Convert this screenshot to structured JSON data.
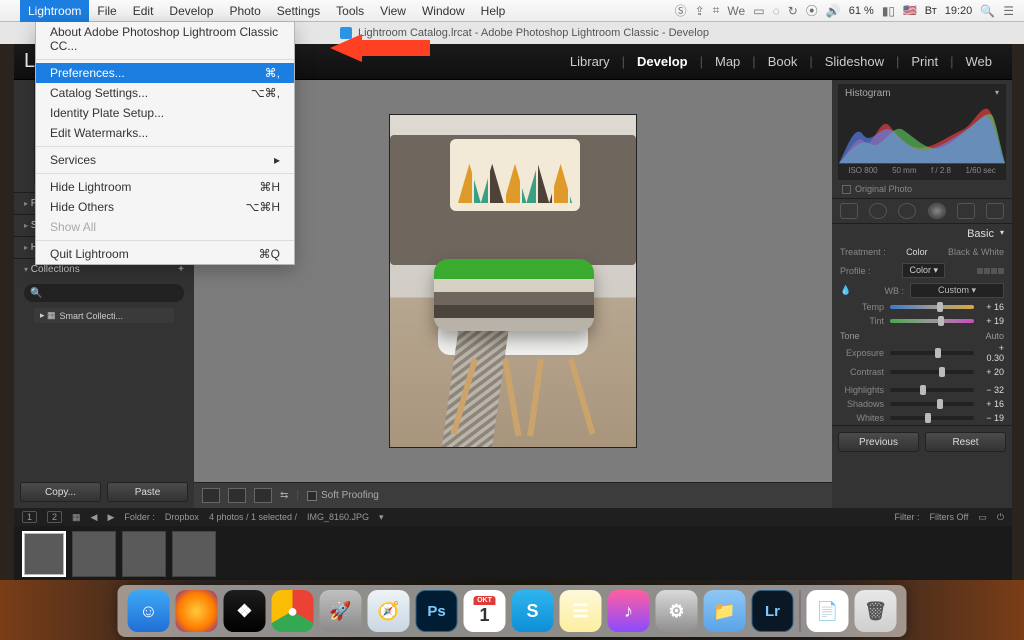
{
  "menubar": {
    "apple": "",
    "items": [
      "Lightroom",
      "File",
      "Edit",
      "Develop",
      "Photo",
      "Settings",
      "Tools",
      "View",
      "Window",
      "Help"
    ],
    "active_index": 0,
    "status": {
      "battery": "61 %",
      "flag": "🇺🇸",
      "day": "Вт",
      "time": "19:20"
    }
  },
  "dropdown": {
    "about": "About Adobe Photoshop Lightroom Classic CC...",
    "preferences": {
      "label": "Preferences...",
      "shortcut": "⌘,"
    },
    "catalog": {
      "label": "Catalog Settings...",
      "shortcut": "⌥⌘,"
    },
    "identity": "Identity Plate Setup...",
    "watermarks": "Edit Watermarks...",
    "services": "Services",
    "hide_lr": {
      "label": "Hide Lightroom",
      "shortcut": "⌘H"
    },
    "hide_others": {
      "label": "Hide Others",
      "shortcut": "⌥⌘H"
    },
    "show_all": "Show All",
    "quit": {
      "label": "Quit Lightroom",
      "shortcut": "⌘Q"
    }
  },
  "titlebar": {
    "text": "Lightroom Catalog.lrcat - Adobe Photoshop Lightroom Classic - Develop"
  },
  "app_top": {
    "logo": "L",
    "modules": [
      "Library",
      "Develop",
      "Map",
      "Book",
      "Slideshow",
      "Print",
      "Web"
    ],
    "active": "Develop"
  },
  "left_panel": {
    "presets": "Presets",
    "snapshots": "Snapshots",
    "history": "History",
    "collections": "Collections",
    "search_placeholder": "",
    "smart": "Smart Collecti...",
    "copy": "Copy...",
    "paste": "Paste"
  },
  "toolbar_bottom": {
    "soft": "Soft Proofing"
  },
  "right_panel": {
    "histogram_title": "Histogram",
    "meta": {
      "iso": "ISO 800",
      "focal": "50 mm",
      "aperture": "f / 2.8",
      "shutter": "1/60 sec"
    },
    "original": "Original Photo",
    "basic": "Basic",
    "treatment": {
      "label": "Treatment :",
      "color": "Color",
      "bw": "Black & White"
    },
    "profile": {
      "label": "Profile :",
      "value": "Color"
    },
    "wb": {
      "label": "WB :",
      "value": "Custom"
    },
    "temp": {
      "label": "Temp",
      "value": "+ 16"
    },
    "tint": {
      "label": "Tint",
      "value": "+ 19"
    },
    "tone": {
      "label": "Tone",
      "auto": "Auto"
    },
    "exposure": {
      "label": "Exposure",
      "value": "+ 0.30"
    },
    "contrast": {
      "label": "Contrast",
      "value": "+ 20"
    },
    "highlights": {
      "label": "Highlights",
      "value": "− 32"
    },
    "shadows": {
      "label": "Shadows",
      "value": "+ 16"
    },
    "whites": {
      "label": "Whites",
      "value": "− 19"
    },
    "previous": "Previous",
    "reset": "Reset"
  },
  "filmstrip_bar": {
    "pages": [
      "1",
      "2"
    ],
    "folder_label": "Folder :",
    "folder": "Dropbox",
    "count": "4 photos / 1 selected /",
    "filename": "IMG_8160.JPG",
    "filter_label": "Filter :",
    "filter_value": "Filters Off"
  },
  "dock": {
    "items": [
      {
        "name": "finder",
        "bg": "linear-gradient(#3fa8f4,#1f6fd6)",
        "txt": "☺"
      },
      {
        "name": "firefox",
        "bg": "radial-gradient(#ffca3a,#ff7b00 60%,#7b2da0)",
        "txt": ""
      },
      {
        "name": "vivaldi",
        "bg": "linear-gradient(#1d1d1d,#000)",
        "txt": "❖"
      },
      {
        "name": "chrome",
        "bg": "conic-gradient(#ea4335 0 120deg,#34a853 120deg 240deg,#fbbc05 240deg 360deg)",
        "txt": "●"
      },
      {
        "name": "launchpad",
        "bg": "linear-gradient(#c0c0c0,#8a8a8a)",
        "txt": "🚀"
      },
      {
        "name": "safari",
        "bg": "linear-gradient(#eef3f7,#c9d6e2)",
        "txt": "🧭"
      },
      {
        "name": "photoshop",
        "bg": "#001d34",
        "txt": "Ps"
      },
      {
        "name": "calendar",
        "bg": "#fff",
        "txt": "1"
      },
      {
        "name": "skype",
        "bg": "linear-gradient(#2fb4ef,#0e8fd6)",
        "txt": "S"
      },
      {
        "name": "notes",
        "bg": "linear-gradient(#fff8d9,#fceea0)",
        "txt": "☰"
      },
      {
        "name": "itunes",
        "bg": "linear-gradient(#ff5fa2,#8a4bff)",
        "txt": "♪"
      },
      {
        "name": "settings",
        "bg": "linear-gradient(#d9d9d9,#8f8f8f)",
        "txt": "⚙"
      },
      {
        "name": "folder",
        "bg": "linear-gradient(#8fc7f4,#5aa3e8)",
        "txt": "📁"
      },
      {
        "name": "lightroom",
        "bg": "#0a1826",
        "txt": "Lr"
      }
    ],
    "right": [
      {
        "name": "document",
        "bg": "#fff",
        "txt": "📄"
      },
      {
        "name": "trash",
        "bg": "linear-gradient(#e8e8e8,#cfcfcf)",
        "txt": "🗑"
      }
    ]
  }
}
